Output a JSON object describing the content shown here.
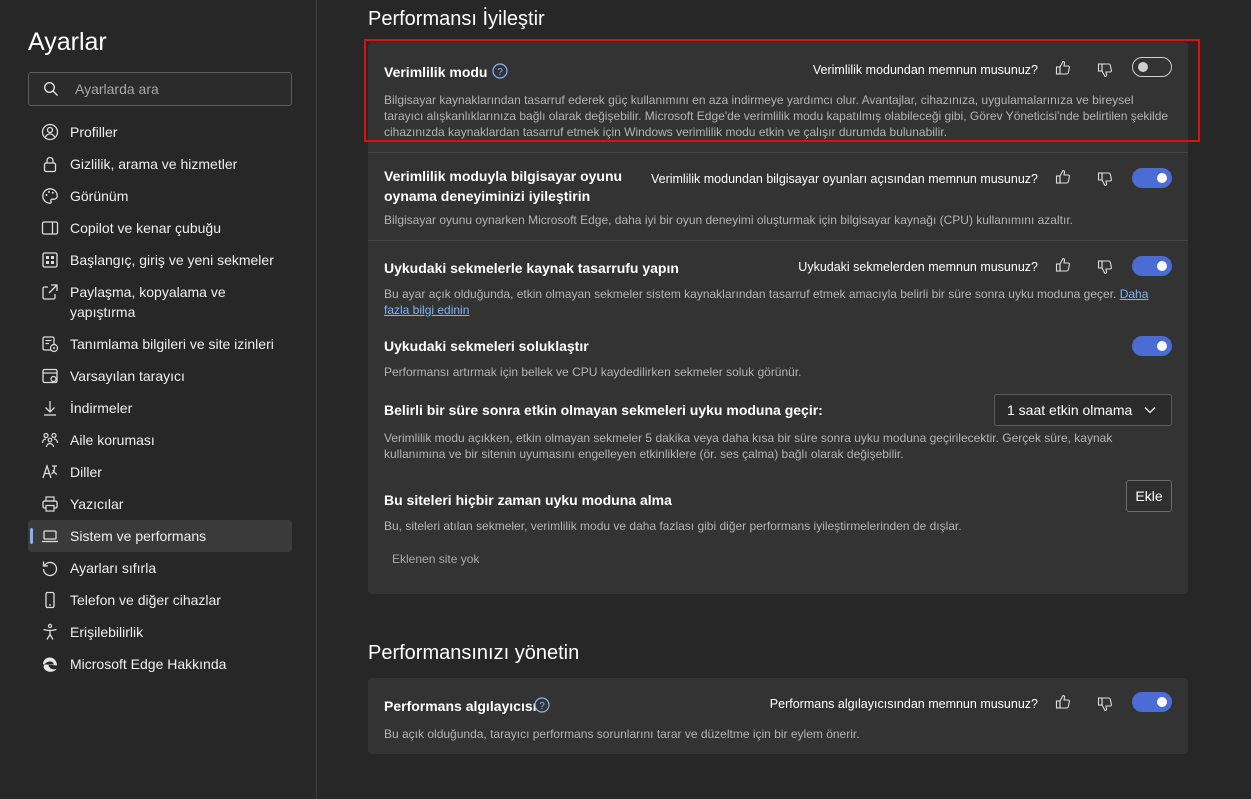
{
  "sidebar": {
    "title": "Ayarlar",
    "search_placeholder": "Ayarlarda ara",
    "items": [
      {
        "label": "Profiller",
        "icon": "profile-icon"
      },
      {
        "label": "Gizlilik, arama ve hizmetler",
        "icon": "lock-icon"
      },
      {
        "label": "Görünüm",
        "icon": "palette-icon"
      },
      {
        "label": "Copilot ve kenar çubuğu",
        "icon": "sidebar-icon"
      },
      {
        "label": "Başlangıç, giriş ve yeni sekmeler",
        "icon": "home-grid-icon"
      },
      {
        "label": "Paylaşma, kopyalama ve yapıştırma",
        "icon": "share-icon"
      },
      {
        "label": "Tanımlama bilgileri ve site izinleri",
        "icon": "cookie-icon"
      },
      {
        "label": "Varsayılan tarayıcı",
        "icon": "browser-icon"
      },
      {
        "label": "İndirmeler",
        "icon": "download-icon"
      },
      {
        "label": "Aile koruması",
        "icon": "family-icon"
      },
      {
        "label": "Diller",
        "icon": "language-icon"
      },
      {
        "label": "Yazıcılar",
        "icon": "printer-icon"
      },
      {
        "label": "Sistem ve performans",
        "icon": "laptop-icon",
        "active": true
      },
      {
        "label": "Ayarları sıfırla",
        "icon": "reset-icon"
      },
      {
        "label": "Telefon ve diğer cihazlar",
        "icon": "phone-icon"
      },
      {
        "label": "Erişilebilirlik",
        "icon": "accessibility-icon"
      },
      {
        "label": "Microsoft Edge Hakkında",
        "icon": "edge-logo-icon"
      }
    ]
  },
  "sections": {
    "improve": {
      "title": "Performansı İyileştir",
      "efficiency": {
        "title": "Verimlilik modu",
        "question": "Verimlilik modundan memnun musunuz?",
        "toggle_on": false,
        "desc": "Bilgisayar kaynaklarından tasarruf ederek güç kullanımını en aza indirmeye yardımcı olur. Avantajlar, cihazınıza, uygulamalarınıza ve bireysel tarayıcı alışkanlıklarınıza bağlı olarak değişebilir. Microsoft Edge'de verimlilik modu kapatılmış olabileceği gibi, Görev Yöneticisi'nde belirtilen şekilde cihazınızda kaynaklardan tasarruf etmek için Windows verimlilik modu etkin ve çalışır durumda bulunabilir."
      },
      "gaming": {
        "title": "Verimlilik moduyla bilgisayar oyunu oynama deneyiminizi iyileştirin",
        "question": "Verimlilik modundan bilgisayar oyunları açısından memnun musunuz?",
        "toggle_on": true,
        "desc": "Bilgisayar oyunu oynarken Microsoft Edge, daha iyi bir oyun deneyimi oluşturmak için bilgisayar kaynağı (CPU) kullanımını azaltır."
      },
      "sleeping_tabs": {
        "title": "Uykudaki sekmelerle kaynak tasarrufu yapın",
        "question": "Uykudaki sekmelerden memnun musunuz?",
        "toggle_on": true,
        "desc": "Bu ayar açık olduğunda, etkin olmayan sekmeler sistem kaynaklarından tasarruf etmek amacıyla belirli bir süre sonra uyku moduna geçer.",
        "link": "Daha fazla bilgi edinin"
      },
      "fade_tabs": {
        "title": "Uykudaki sekmeleri soluklaştır",
        "toggle_on": true,
        "desc": "Performansı artırmak için bellek ve CPU kaydedilirken sekmeler soluk görünür."
      },
      "sleep_after": {
        "title": "Belirli bir süre sonra etkin olmayan sekmeleri uyku moduna geçir:",
        "selected": "1 saat etkin olmama",
        "desc": "Verimlilik modu açıkken, etkin olmayan sekmeler 5 dakika veya daha kısa bir süre sonra uyku moduna geçirilecektir. Gerçek süre, kaynak kullanımına ve bir sitenin uyumasını engelleyen etkinliklere (ör. ses çalma) bağlı olarak değişebilir."
      },
      "never_sleep": {
        "title": "Bu siteleri hiçbir zaman uyku moduna alma",
        "button": "Ekle",
        "desc": "Bu, siteleri atılan sekmeler, verimlilik modu ve daha fazlası gibi diğer performans iyileştirmelerinden de dışlar.",
        "empty": "Eklenen site yok"
      }
    },
    "manage": {
      "title": "Performansınızı yönetin",
      "detector": {
        "title": "Performans algılayıcısı",
        "question": "Performans algılayıcısından memnun musunuz?",
        "toggle_on": true,
        "desc": "Bu açık olduğunda, tarayıcı performans sorunlarını tarar ve düzeltme için bir eylem önerir."
      }
    }
  },
  "colors": {
    "accent": "#4a6cd4",
    "highlight": "#e01010",
    "link": "#79b6ff"
  }
}
